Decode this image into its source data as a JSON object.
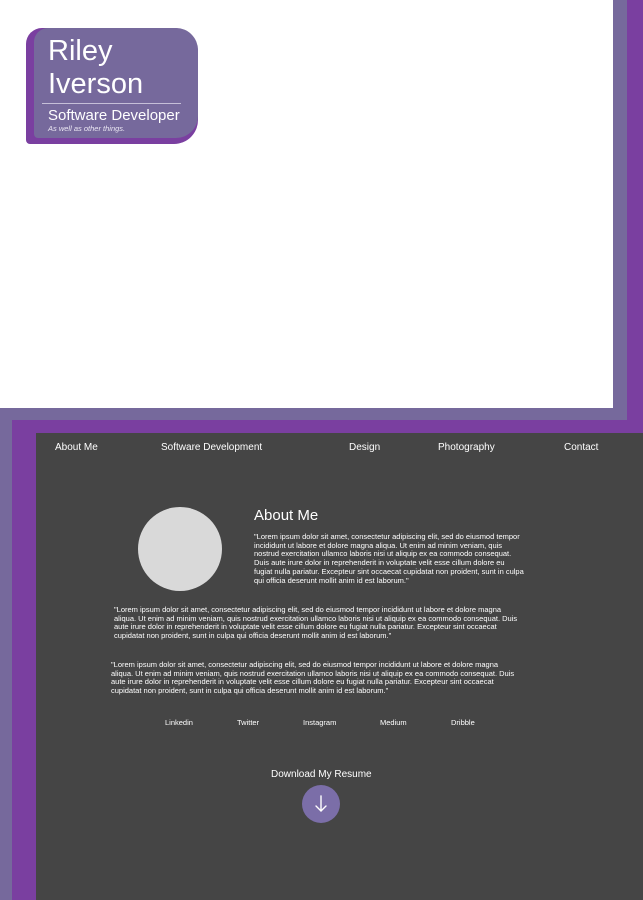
{
  "header": {
    "first_name": "Riley",
    "last_name": "Iverson",
    "role": "Software Developer",
    "tagline": "As well as other things."
  },
  "nav": {
    "items": [
      {
        "label": "About Me"
      },
      {
        "label": "Software Development"
      },
      {
        "label": "Design"
      },
      {
        "label": "Photography"
      },
      {
        "label": "Contact"
      }
    ]
  },
  "about": {
    "heading": "About Me",
    "paragraphs": [
      "\"Lorem ipsum dolor sit amet, consectetur adipiscing elit, sed do eiusmod tempor incididunt ut labore et dolore magna aliqua. Ut enim ad minim veniam, quis nostrud exercitation ullamco laboris nisi ut aliquip ex ea commodo consequat. Duis aute irure dolor in reprehenderit in voluptate velit esse cillum dolore eu fugiat nulla pariatur. Excepteur sint occaecat cupidatat non proident, sunt in culpa qui officia deserunt mollit anim id est laborum.\"",
      "\"Lorem ipsum dolor sit amet, consectetur adipiscing elit, sed do eiusmod tempor incididunt ut labore et dolore magna aliqua. Ut enim ad minim veniam, quis nostrud exercitation ullamco laboris nisi ut aliquip ex ea commodo consequat. Duis aute irure dolor in reprehenderit in voluptate velit esse cillum dolore eu fugiat nulla pariatur. Excepteur sint occaecat cupidatat non proident, sunt in culpa qui officia deserunt mollit anim id est laborum.\"",
      "\"Lorem ipsum dolor sit amet, consectetur adipiscing elit, sed do eiusmod tempor incididunt ut labore et dolore magna aliqua. Ut enim ad minim veniam, quis nostrud exercitation ullamco laboris nisi ut aliquip ex ea commodo consequat. Duis aute irure dolor in reprehenderit in voluptate velit esse cillum dolore eu fugiat nulla pariatur. Excepteur sint occaecat cupidatat non proident, sunt in culpa qui officia deserunt mollit anim id est laborum.\""
    ]
  },
  "social": {
    "links": [
      {
        "label": "Linkedin"
      },
      {
        "label": "Twitter"
      },
      {
        "label": "Instagram"
      },
      {
        "label": "Medium"
      },
      {
        "label": "Dribble"
      }
    ]
  },
  "resume": {
    "label": "Download My Resume",
    "icon": "arrow-down-icon"
  },
  "colors": {
    "accent_dark": "#7a3fa0",
    "accent_light": "#76699c",
    "panel": "#454545",
    "avatar_placeholder": "#d9d9d9",
    "button": "#7b6ea8"
  }
}
